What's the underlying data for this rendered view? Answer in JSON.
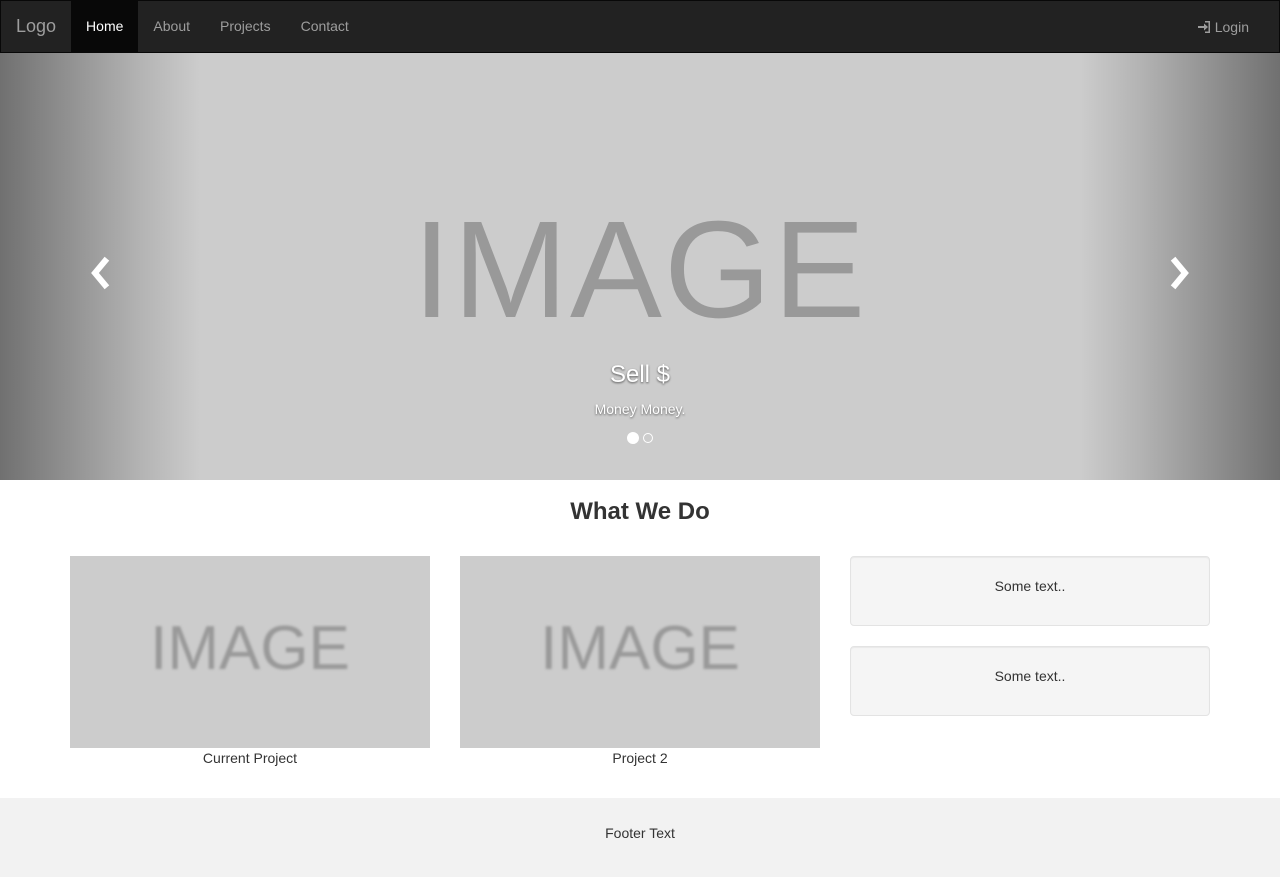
{
  "navbar": {
    "brand": "Logo",
    "items": [
      {
        "label": "Home",
        "active": true
      },
      {
        "label": "About",
        "active": false
      },
      {
        "label": "Projects",
        "active": false
      },
      {
        "label": "Contact",
        "active": false
      }
    ],
    "login_label": "Login",
    "login_icon": "log-in-icon"
  },
  "carousel": {
    "image_text": "IMAGE",
    "caption_title": "Sell $",
    "caption_text": "Money Money.",
    "prev_icon": "chevron-left-icon",
    "next_icon": "chevron-right-icon",
    "slide_count": 2,
    "active_slide": 1
  },
  "main": {
    "section_title": "What We Do",
    "projects": [
      {
        "image_text": "IMAGE",
        "caption": "Current Project"
      },
      {
        "image_text": "IMAGE",
        "caption": "Project 2"
      }
    ],
    "wells": [
      {
        "text": "Some text.."
      },
      {
        "text": "Some text.."
      }
    ]
  },
  "footer": {
    "text": "Footer Text"
  },
  "colors": {
    "navbar_bg": "#222222",
    "nav_active_bg": "#080808",
    "nav_text": "#9d9d9d",
    "placeholder_bg": "#cccccc",
    "placeholder_text": "#999999",
    "footer_bg": "#f2f2f2"
  }
}
